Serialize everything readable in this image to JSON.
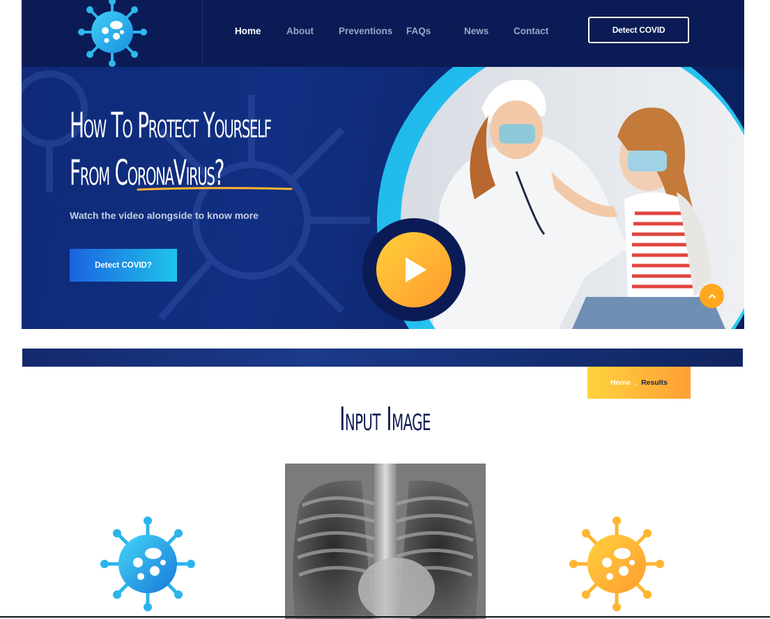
{
  "header": {
    "logo_icon": "virus-logo-icon",
    "nav": [
      {
        "label": "Home",
        "active": true
      },
      {
        "label": "About",
        "active": false
      },
      {
        "label": "Preventions",
        "active": false
      },
      {
        "label": "FAQs",
        "active": false
      },
      {
        "label": "News",
        "active": false
      },
      {
        "label": "Contact",
        "active": false
      }
    ],
    "cta_label": "Detect COVID"
  },
  "hero": {
    "title_line1": "How To Protect Yourself",
    "title_line2": "From CoronaVirus?",
    "subtitle": "Watch the video alongside to know more",
    "cta_label": "Detect COVID?",
    "play_icon": "play-icon"
  },
  "breadcrumb": {
    "home": "Home",
    "separator": ".",
    "current": "Results"
  },
  "section": {
    "title": "Input Image"
  },
  "colors": {
    "navy": "#0b1b55",
    "accent_orange": "#ff9b2e",
    "accent_yellow": "#ffcf3a",
    "accent_blue": "#1fb6ea"
  }
}
